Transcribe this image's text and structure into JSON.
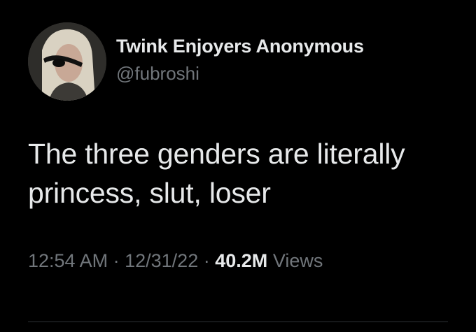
{
  "author": {
    "display_name": "Twink Enjoyers Anonymous",
    "handle": "@fubroshi",
    "avatar_icon": "profile-avatar"
  },
  "tweet": {
    "lines": [
      "The three genders are literally",
      "princess, slut, loser"
    ]
  },
  "meta": {
    "time": "12:54 AM",
    "separator": "·",
    "date": "12/31/22",
    "views_count": "40.2M",
    "views_label": "Views"
  },
  "colors": {
    "background": "#000000",
    "primary_text": "#e7e9ea",
    "secondary_text": "#71767b",
    "divider": "#2f3336"
  }
}
